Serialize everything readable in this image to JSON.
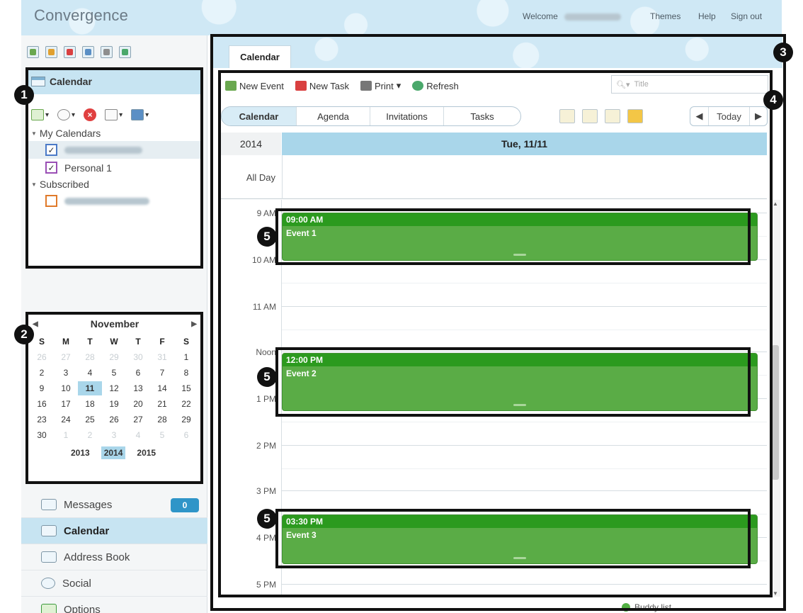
{
  "header": {
    "logo": "Convergence",
    "welcome": "Welcome",
    "links": [
      "Themes",
      "Help",
      "Sign out"
    ]
  },
  "quick_icons": [
    "new-event-icon",
    "new-task-icon",
    "compose-icon",
    "import-icon",
    "export-icon",
    "apps-icon"
  ],
  "calendar_panel": {
    "title": "Calendar",
    "tools": [
      "add-calendar-icon",
      "settings-icon",
      "delete-icon",
      "view-icon",
      "share-icon"
    ],
    "groups": [
      {
        "label": "My Calendars",
        "items": [
          {
            "label": "",
            "checked": true,
            "color": "#4b7ac7"
          },
          {
            "label": "Personal 1",
            "checked": true,
            "color": "#9a4fb5"
          }
        ]
      },
      {
        "label": "Subscribed",
        "items": [
          {
            "label": "",
            "checked": false,
            "color": "#e07a2a"
          }
        ]
      }
    ]
  },
  "mini_calendar": {
    "month": "November",
    "dow": [
      "S",
      "M",
      "T",
      "W",
      "T",
      "F",
      "S"
    ],
    "weeks": [
      [
        "26",
        "27",
        "28",
        "29",
        "30",
        "31",
        "1"
      ],
      [
        "2",
        "3",
        "4",
        "5",
        "6",
        "7",
        "8"
      ],
      [
        "9",
        "10",
        "11",
        "12",
        "13",
        "14",
        "15"
      ],
      [
        "16",
        "17",
        "18",
        "19",
        "20",
        "21",
        "22"
      ],
      [
        "23",
        "24",
        "25",
        "26",
        "27",
        "28",
        "29"
      ],
      [
        "30",
        "1",
        "2",
        "3",
        "4",
        "5",
        "6"
      ]
    ],
    "today": "11",
    "years": [
      "2013",
      "2014",
      "2015"
    ],
    "current_year": "2014"
  },
  "nav": [
    {
      "label": "Messages",
      "count": "0",
      "active": false
    },
    {
      "label": "Calendar",
      "active": true
    },
    {
      "label": "Address Book",
      "active": false
    },
    {
      "label": "Social",
      "active": false
    },
    {
      "label": "Options",
      "active": false
    }
  ],
  "main": {
    "tab": "Calendar",
    "toolbar": {
      "new_event": "New Event",
      "new_task": "New Task",
      "print": "Print",
      "refresh": "Refresh",
      "search_placeholder": "Title"
    },
    "views": [
      "Calendar",
      "Agenda",
      "Invitations",
      "Tasks"
    ],
    "active_view": "Calendar",
    "today_label": "Today",
    "year": "2014",
    "date": "Tue, 11/11",
    "allday_label": "All Day",
    "hours": [
      "9 AM",
      "10 AM",
      "11 AM",
      "Noon",
      "1 PM",
      "2 PM",
      "3 PM",
      "4 PM",
      "5 PM"
    ],
    "events": [
      {
        "time": "09:00 AM",
        "title": "Event 1"
      },
      {
        "time": "12:00 PM",
        "title": "Event 2"
      },
      {
        "time": "03:30 PM",
        "title": "Event 3"
      }
    ]
  },
  "callouts": [
    "1",
    "2",
    "3",
    "4",
    "5",
    "5",
    "5"
  ],
  "buddy_list": "Buddy list",
  "colors": {
    "accent": "#a9d6ea",
    "event": "#5aac46",
    "event_header": "#2b9a1e",
    "badge": "#2f95c8"
  }
}
